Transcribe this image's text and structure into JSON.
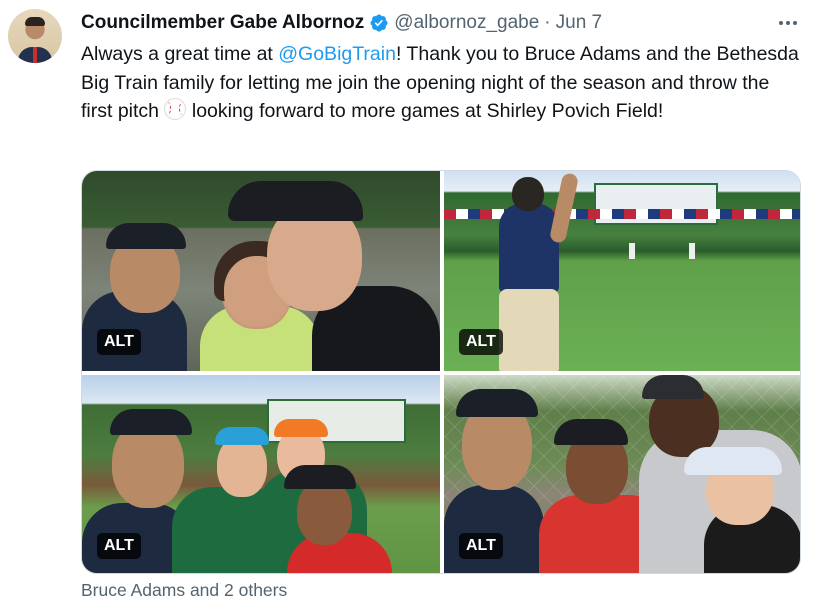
{
  "author": {
    "display_name": "Councilmember Gabe Albornoz",
    "handle": "@albornoz_gabe",
    "separator": "·",
    "date": "Jun 7",
    "verified_icon": "verified-badge-icon",
    "verified_color": "#1d9bf0"
  },
  "tweet": {
    "text_part1": "Always a great time at ",
    "mention": "@GoBigTrain",
    "text_part2": "! Thank you to Bruce Adams and the Bethesda Big Train family for letting me join the opening night of the season and throw the first pitch ",
    "emoji": "baseball-icon",
    "text_part3": " looking forward to more games at Shirley Povich Field!"
  },
  "media": {
    "photos": [
      {
        "alt_label": "ALT"
      },
      {
        "alt_label": "ALT"
      },
      {
        "alt_label": "ALT"
      },
      {
        "alt_label": "ALT"
      }
    ]
  },
  "tagged": "Bruce Adams and 2 others",
  "colors": {
    "link": "#1d9bf0",
    "secondary_text": "#536471",
    "border": "#cfd9de"
  }
}
